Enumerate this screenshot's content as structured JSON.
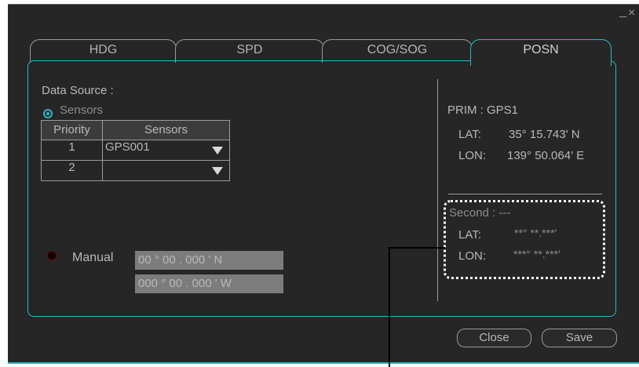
{
  "window": {
    "minimize_glyph": "_",
    "close_glyph": "×"
  },
  "tabs": [
    "HDG",
    "SPD",
    "COG/SOG",
    "POSN"
  ],
  "active_tab": "POSN",
  "data_source": {
    "label": "Data Source :",
    "sensors_option": "Sensors",
    "sensors_selected": true,
    "table": {
      "headers": [
        "Priority",
        "Sensors"
      ],
      "rows": [
        {
          "priority": "1",
          "sensor": "GPS001"
        },
        {
          "priority": "2",
          "sensor": ""
        }
      ]
    },
    "manual_option": "Manual",
    "manual_selected": false,
    "manual_lat": "00 ° 00 . 000 ' N",
    "manual_lon": "000 ° 00 . 000 ' W"
  },
  "status": {
    "prim": "PRIM :  GPS1",
    "prim_lat_label": "LAT:",
    "prim_lat_value": "35° 15.743' N",
    "prim_lon_label": "LON:",
    "prim_lon_value": "139° 50.064' E",
    "second": "Second :  ---",
    "second_lat_label": "LAT:",
    "second_lat_value": "**° **.***'",
    "second_lon_label": "LON:",
    "second_lon_value": "***° **.***'"
  },
  "buttons": {
    "close": "Close",
    "save": "Save"
  },
  "colors": {
    "accent": "#2fb6c8",
    "background": "#262626",
    "text": "#b8b8b8"
  }
}
